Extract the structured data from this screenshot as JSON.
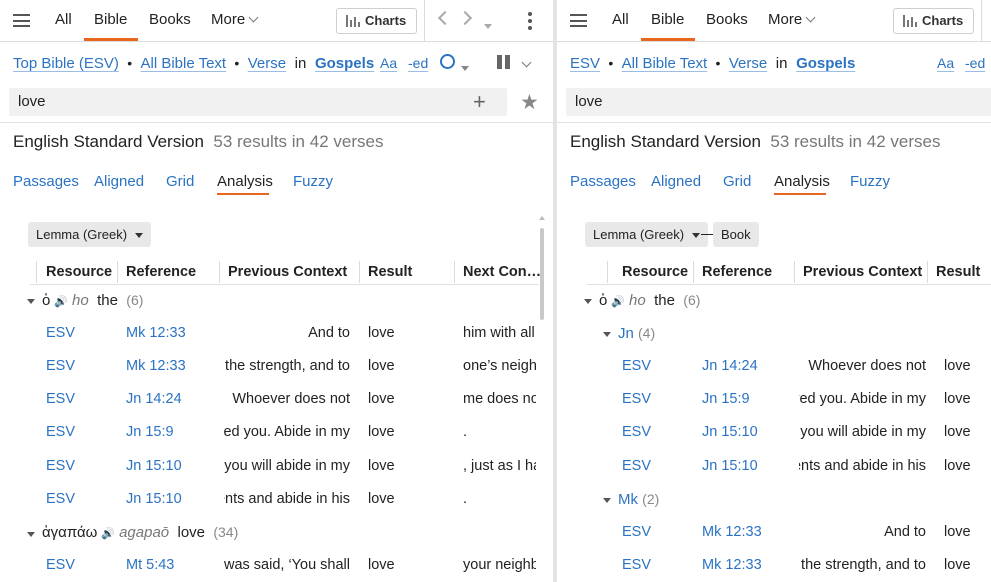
{
  "left": {
    "tabs": [
      "All",
      "Bible",
      "Books",
      "More"
    ],
    "charts_label": "Charts",
    "breadcrumb": {
      "resource": "Top Bible (ESV)",
      "scope": "All Bible Text",
      "unit": "Verse",
      "in": "in",
      "range": "Gospels"
    },
    "toolbar": {
      "font_label": "Aa",
      "ed_label": "-ed"
    },
    "search": {
      "value": "love"
    },
    "title": "English Standard Version",
    "count": "53 results in 42 verses",
    "subtabs": [
      "Passages",
      "Aligned",
      "Grid",
      "Analysis",
      "Fuzzy"
    ],
    "chip": "Lemma (Greek)",
    "columns": [
      "Resource",
      "Reference",
      "Previous Context",
      "Result",
      "Next Con…"
    ],
    "groups": [
      {
        "lemma": "ὁ",
        "translit": "ho",
        "gloss": "the",
        "count": "(6)"
      },
      {
        "lemma": "ἀγαπάω",
        "translit": "agapaō",
        "gloss": "love",
        "count": "(34)"
      }
    ],
    "rows": [
      {
        "res": "ESV",
        "ref": "Mk 12:33",
        "prev": "And to",
        "result": "love",
        "next": "him with all"
      },
      {
        "res": "ESV",
        "ref": "Mk 12:33",
        "prev": "the strength, and to",
        "result": "love",
        "next": "one’s neighbor"
      },
      {
        "res": "ESV",
        "ref": "Jn 14:24",
        "prev": "Whoever does not",
        "result": "love",
        "next": "me does not"
      },
      {
        "res": "ESV",
        "ref": "Jn 15:9",
        "prev": "loved you. Abide in my",
        "result": "love",
        "next": "."
      },
      {
        "res": "ESV",
        "ref": "Jn 15:10",
        "prev": "you will abide in my",
        "result": "love",
        "next": ", just as I have"
      },
      {
        "res": "ESV",
        "ref": "Jn 15:10",
        "prev": "ments and abide in his",
        "result": "love",
        "next": "."
      },
      {
        "res": "ESV",
        "ref": "Mt 5:43",
        "prev": "was said, ‘You shall",
        "result": "love",
        "next": "your neighbor"
      }
    ]
  },
  "right": {
    "tabs": [
      "All",
      "Bible",
      "Books",
      "More"
    ],
    "charts_label": "Charts",
    "breadcrumb": {
      "resource": "ESV",
      "scope": "All Bible Text",
      "unit": "Verse",
      "in": "in",
      "range": "Gospels"
    },
    "toolbar": {
      "font_label": "Aa",
      "ed_label": "-ed"
    },
    "search": {
      "value": "love"
    },
    "title": "English Standard Version",
    "count": "53 results in 42 verses",
    "subtabs": [
      "Passages",
      "Aligned",
      "Grid",
      "Analysis",
      "Fuzzy"
    ],
    "chip": "Lemma (Greek)",
    "chip2": "Book",
    "columns": [
      "Resource",
      "Reference",
      "Previous Context",
      "Result"
    ],
    "group": {
      "lemma": "ὁ",
      "translit": "ho",
      "gloss": "the",
      "count": "(6)"
    },
    "subgroups": [
      {
        "name": "Jn",
        "count": "(4)"
      },
      {
        "name": "Mk",
        "count": "(2)"
      }
    ],
    "rows": [
      {
        "res": "ESV",
        "ref": "Jn 14:24",
        "prev": "Whoever does not",
        "result": "love"
      },
      {
        "res": "ESV",
        "ref": "Jn 15:9",
        "prev": "loved you. Abide in my",
        "result": "love"
      },
      {
        "res": "ESV",
        "ref": "Jn 15:10",
        "prev": "you will abide in my",
        "result": "love"
      },
      {
        "res": "ESV",
        "ref": "Jn 15:10",
        "prev": "ments and abide in his",
        "result": "love"
      },
      {
        "res": "ESV",
        "ref": "Mk 12:33",
        "prev": "And to",
        "result": "love"
      },
      {
        "res": "ESV",
        "ref": "Mk 12:33",
        "prev": "the strength, and to",
        "result": "love"
      }
    ]
  }
}
